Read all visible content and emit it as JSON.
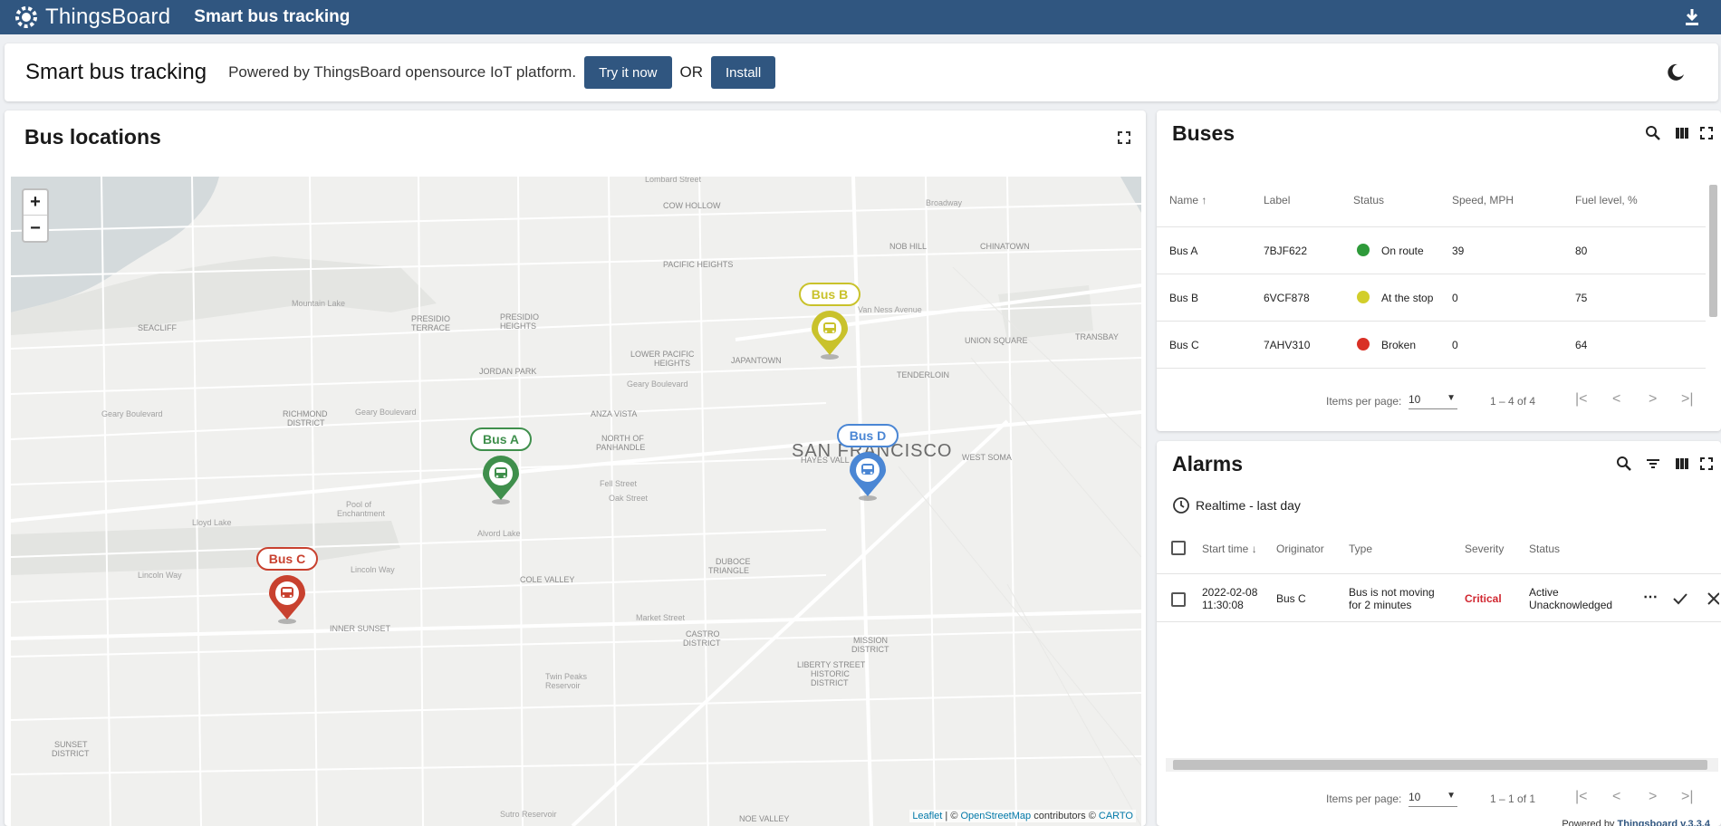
{
  "topbar": {
    "logo_text": "ThingsBoard",
    "dashboard_title": "Smart bus tracking"
  },
  "header": {
    "title": "Smart bus tracking",
    "powered_text": "Powered by ThingsBoard opensource IoT platform.",
    "try_button": "Try it now",
    "or_text": "OR",
    "install_button": "Install"
  },
  "map": {
    "title": "Bus locations",
    "city_label": "SAN FRANCISCO",
    "zoom_in": "+",
    "zoom_out": "−",
    "attribution": {
      "leaflet": "Leaflet",
      "sep": " | © ",
      "osm": "OpenStreetMap",
      "contrib": " contributors © ",
      "carto": "CARTO"
    },
    "markers": [
      {
        "label": "Bus A",
        "color": "#3f8f4c"
      },
      {
        "label": "Bus B",
        "color": "#c9c22b"
      },
      {
        "label": "Bus C",
        "color": "#c8412f"
      },
      {
        "label": "Bus D",
        "color": "#4a86d4"
      }
    ],
    "place_labels": [
      "COW HOLLOW",
      "PACIFIC HEIGHTS",
      "NOB HILL",
      "CHINATOWN",
      "SEACLIFF",
      "PRESIDIO TERRACE",
      "PRESIDIO HEIGHTS",
      "JORDAN PARK",
      "LOWER PACIFIC HEIGHTS",
      "JAPANTOWN",
      "UNION SQUARE",
      "TRANSBAY",
      "TENDERLOIN",
      "RICHMOND DISTRICT",
      "ANZA VISTA",
      "NORTH OF PANHANDLE",
      "HAYES VALL",
      "WEST SOMA",
      "DUBOCE TRIANGLE",
      "COLE VALLEY",
      "INNER SUNSET",
      "CASTRO DISTRICT",
      "MISSION DISTRICT",
      "LIBERTY STREET HISTORIC DISTRICT",
      "SUNSET DISTRICT",
      "NOE VALLEY",
      "Geary Boulevard",
      "Lincoln Way",
      "Fell Street",
      "Oak Street",
      "Market Street",
      "Mountain Lake",
      "Lloyd Lake",
      "Alvord Lake",
      "Pool of Enchantment",
      "Twin Peaks Reservoir",
      "Sutro Reservoir",
      "Lombard Street",
      "Broadway",
      "Van Ness Avenue"
    ]
  },
  "buses": {
    "title": "Buses",
    "columns": [
      "Name",
      "Label",
      "Status",
      "Speed, MPH",
      "Fuel level, %"
    ],
    "rows": [
      {
        "name": "Bus A",
        "label": "7BJF622",
        "status": "On route",
        "status_color": "#2e9a3a",
        "speed": "39",
        "fuel": "80"
      },
      {
        "name": "Bus B",
        "label": "6VCF878",
        "status": "At the stop",
        "status_color": "#d2ce2b",
        "speed": "0",
        "fuel": "75"
      },
      {
        "name": "Bus C",
        "label": "7AHV310",
        "status": "Broken",
        "status_color": "#d93025",
        "speed": "0",
        "fuel": "64"
      }
    ],
    "pager": {
      "items_per_page": "Items per page:",
      "page_size": "10",
      "range": "1 – 4 of 4"
    }
  },
  "alarms": {
    "title": "Alarms",
    "timewindow": "Realtime - last day",
    "columns": [
      "Start time",
      "Originator",
      "Type",
      "Severity",
      "Status"
    ],
    "rows": [
      {
        "start_time_date": "2022-02-08",
        "start_time_time": "11:30:08",
        "originator": "Bus C",
        "type_line1": "Bus is not moving",
        "type_line2": "for 2 minutes",
        "severity": "Critical",
        "status_line1": "Active",
        "status_line2": "Unacknowledged"
      }
    ],
    "pager": {
      "items_per_page": "Items per page:",
      "page_size": "10",
      "range": "1 – 1 of 1"
    },
    "footer": {
      "powered": "Powered by ",
      "link": "Thingsboard v.3.3.4"
    }
  }
}
